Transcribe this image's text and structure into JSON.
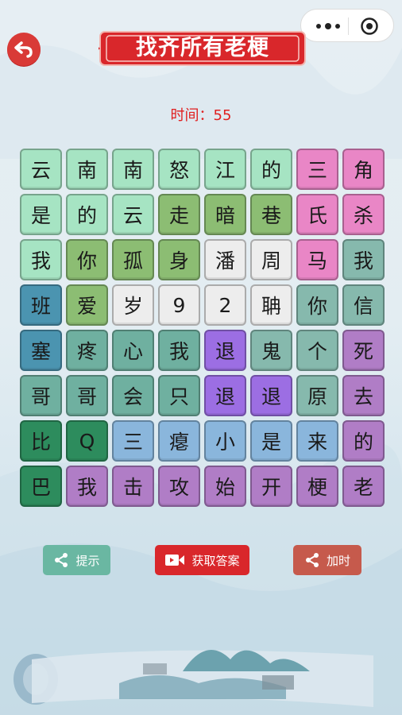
{
  "header": {
    "title": "找齐所有老梗",
    "timer_label": "时间：55"
  },
  "board": {
    "rows": [
      [
        {
          "t": "云",
          "c": "mint"
        },
        {
          "t": "南",
          "c": "mint"
        },
        {
          "t": "南",
          "c": "mint"
        },
        {
          "t": "怒",
          "c": "mint"
        },
        {
          "t": "江",
          "c": "mint"
        },
        {
          "t": "的",
          "c": "mint"
        },
        {
          "t": "三",
          "c": "pink"
        },
        {
          "t": "角",
          "c": "pink"
        }
      ],
      [
        {
          "t": "是",
          "c": "mint"
        },
        {
          "t": "的",
          "c": "mint"
        },
        {
          "t": "云",
          "c": "mint"
        },
        {
          "t": "走",
          "c": "olive"
        },
        {
          "t": "暗",
          "c": "olive"
        },
        {
          "t": "巷",
          "c": "olive"
        },
        {
          "t": "氏",
          "c": "pink"
        },
        {
          "t": "杀",
          "c": "pink"
        }
      ],
      [
        {
          "t": "我",
          "c": "mint"
        },
        {
          "t": "你",
          "c": "olive"
        },
        {
          "t": "孤",
          "c": "olive"
        },
        {
          "t": "身",
          "c": "olive"
        },
        {
          "t": "潘",
          "c": "white"
        },
        {
          "t": "周",
          "c": "white"
        },
        {
          "t": "马",
          "c": "pink"
        },
        {
          "t": "我",
          "c": "teal"
        }
      ],
      [
        {
          "t": "班",
          "c": "blue"
        },
        {
          "t": "爱",
          "c": "olive"
        },
        {
          "t": "岁",
          "c": "white"
        },
        {
          "t": "9",
          "c": "white"
        },
        {
          "t": "2",
          "c": "white"
        },
        {
          "t": "聃",
          "c": "white"
        },
        {
          "t": "你",
          "c": "teal"
        },
        {
          "t": "信",
          "c": "teal"
        }
      ],
      [
        {
          "t": "塞",
          "c": "blue"
        },
        {
          "t": "疼",
          "c": "green2"
        },
        {
          "t": "心",
          "c": "green2"
        },
        {
          "t": "我",
          "c": "green2"
        },
        {
          "t": "退",
          "c": "purple"
        },
        {
          "t": "鬼",
          "c": "teal"
        },
        {
          "t": "个",
          "c": "teal"
        },
        {
          "t": "死",
          "c": "lilac"
        }
      ],
      [
        {
          "t": "哥",
          "c": "green2"
        },
        {
          "t": "哥",
          "c": "green2"
        },
        {
          "t": "会",
          "c": "green2"
        },
        {
          "t": "只",
          "c": "green2"
        },
        {
          "t": "退",
          "c": "purple"
        },
        {
          "t": "退",
          "c": "purple"
        },
        {
          "t": "原",
          "c": "teal"
        },
        {
          "t": "去",
          "c": "lilac"
        }
      ],
      [
        {
          "t": "比",
          "c": "dkgreen"
        },
        {
          "t": "Q",
          "c": "dkgreen"
        },
        {
          "t": "三",
          "c": "sky"
        },
        {
          "t": "瘪",
          "c": "sky"
        },
        {
          "t": "小",
          "c": "sky"
        },
        {
          "t": "是",
          "c": "sky"
        },
        {
          "t": "来",
          "c": "sky"
        },
        {
          "t": "的",
          "c": "lilac"
        }
      ],
      [
        {
          "t": "巴",
          "c": "dkgreen"
        },
        {
          "t": "我",
          "c": "lilac"
        },
        {
          "t": "击",
          "c": "lilac"
        },
        {
          "t": "攻",
          "c": "lilac"
        },
        {
          "t": "始",
          "c": "lilac"
        },
        {
          "t": "开",
          "c": "lilac"
        },
        {
          "t": "梗",
          "c": "lilac"
        },
        {
          "t": "老",
          "c": "lilac"
        }
      ]
    ]
  },
  "buttons": {
    "hint_label": "提示",
    "answer_label": "获取答案",
    "addtime_label": "加时"
  },
  "icons": {
    "back": "back-arrow-icon",
    "more": "more-dots-icon",
    "close": "target-close-icon",
    "share": "share-icon",
    "video": "video-icon"
  },
  "colors": {
    "accent_red": "#d9272b",
    "timer": "#e02020"
  }
}
